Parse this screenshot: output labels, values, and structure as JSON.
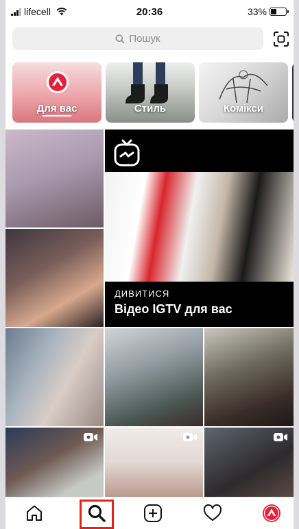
{
  "status_bar": {
    "carrier": "lifecell",
    "time": "20:36",
    "battery": "33%"
  },
  "search": {
    "placeholder": "Пошук"
  },
  "topics": [
    {
      "label": "Для вас",
      "icon": "igtv-red-logo-icon",
      "selected": true
    },
    {
      "label": "Стиль"
    },
    {
      "label": "Комікси"
    }
  ],
  "igtv_card": {
    "kicker": "ДИВИТИСЯ",
    "title": "Відео IGTV для вас",
    "icon": "igtv-icon"
  },
  "tab_bar": {
    "items": [
      {
        "name": "home-icon"
      },
      {
        "name": "search-icon",
        "active": true
      },
      {
        "name": "new-post-icon"
      },
      {
        "name": "heart-icon"
      },
      {
        "name": "igtv-profile-icon"
      }
    ]
  },
  "colors": {
    "accent_red": "#e2231a",
    "ig_red": "#e3223a"
  }
}
